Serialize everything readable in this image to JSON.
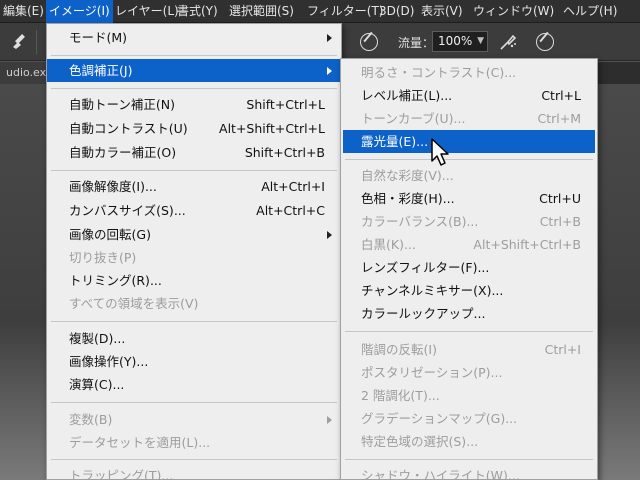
{
  "menubar": {
    "items": [
      {
        "label": "編集(E)"
      },
      {
        "label": "イメージ(I)"
      },
      {
        "label": "レイヤー(L)"
      },
      {
        "label": "書式(Y)"
      },
      {
        "label": "選択範囲(S)"
      },
      {
        "label": "フィルター(T)"
      },
      {
        "label": "3D(D)"
      },
      {
        "label": "表示(V)"
      },
      {
        "label": "ウィンドウ(W)"
      },
      {
        "label": "ヘルプ(H)"
      }
    ]
  },
  "options_bar": {
    "flow_label": "流量：",
    "flow_value": "100%"
  },
  "document_tab": "udio.exr @",
  "image_menu": {
    "items": [
      {
        "label": "モード(M)",
        "shortcut": ""
      },
      {
        "label": "色調補正(J)",
        "shortcut": ""
      },
      {
        "label": "自動トーン補正(N)",
        "shortcut": "Shift+Ctrl+L"
      },
      {
        "label": "自動コントラスト(U)",
        "shortcut": "Alt+Shift+Ctrl+L"
      },
      {
        "label": "自動カラー補正(O)",
        "shortcut": "Shift+Ctrl+B"
      },
      {
        "label": "画像解像度(I)...",
        "shortcut": "Alt+Ctrl+I"
      },
      {
        "label": "カンバスサイズ(S)...",
        "shortcut": "Alt+Ctrl+C"
      },
      {
        "label": "画像の回転(G)",
        "shortcut": ""
      },
      {
        "label": "切り抜き(P)",
        "shortcut": ""
      },
      {
        "label": "トリミング(R)...",
        "shortcut": ""
      },
      {
        "label": "すべての領域を表示(V)",
        "shortcut": ""
      },
      {
        "label": "複製(D)...",
        "shortcut": ""
      },
      {
        "label": "画像操作(Y)...",
        "shortcut": ""
      },
      {
        "label": "演算(C)...",
        "shortcut": ""
      },
      {
        "label": "変数(B)",
        "shortcut": ""
      },
      {
        "label": "データセットを適用(L)...",
        "shortcut": ""
      },
      {
        "label": "トラッピング(T)...",
        "shortcut": ""
      }
    ]
  },
  "adjustments_menu": {
    "items": [
      {
        "label": "明るさ・コントラスト(C)...",
        "shortcut": ""
      },
      {
        "label": "レベル補正(L)...",
        "shortcut": "Ctrl+L"
      },
      {
        "label": "トーンカーブ(U)...",
        "shortcut": "Ctrl+M"
      },
      {
        "label": "露光量(E)...",
        "shortcut": ""
      },
      {
        "label": "自然な彩度(V)...",
        "shortcut": ""
      },
      {
        "label": "色相・彩度(H)...",
        "shortcut": "Ctrl+U"
      },
      {
        "label": "カラーバランス(B)...",
        "shortcut": "Ctrl+B"
      },
      {
        "label": "白黒(K)...",
        "shortcut": "Alt+Shift+Ctrl+B"
      },
      {
        "label": "レンズフィルター(F)...",
        "shortcut": ""
      },
      {
        "label": "チャンネルミキサー(X)...",
        "shortcut": ""
      },
      {
        "label": "カラールックアップ...",
        "shortcut": ""
      },
      {
        "label": "階調の反転(I)",
        "shortcut": "Ctrl+I"
      },
      {
        "label": "ポスタリゼーション(P)...",
        "shortcut": ""
      },
      {
        "label": "2 階調化(T)...",
        "shortcut": ""
      },
      {
        "label": "グラデーションマップ(G)...",
        "shortcut": ""
      },
      {
        "label": "特定色域の選択(S)...",
        "shortcut": ""
      },
      {
        "label": "シャドウ・ハイライト(W)...",
        "shortcut": ""
      }
    ]
  },
  "colors": {
    "highlight": "#0c62c8",
    "menu_bg": "#eeeeee",
    "disabled_text": "#9d9d9d"
  }
}
